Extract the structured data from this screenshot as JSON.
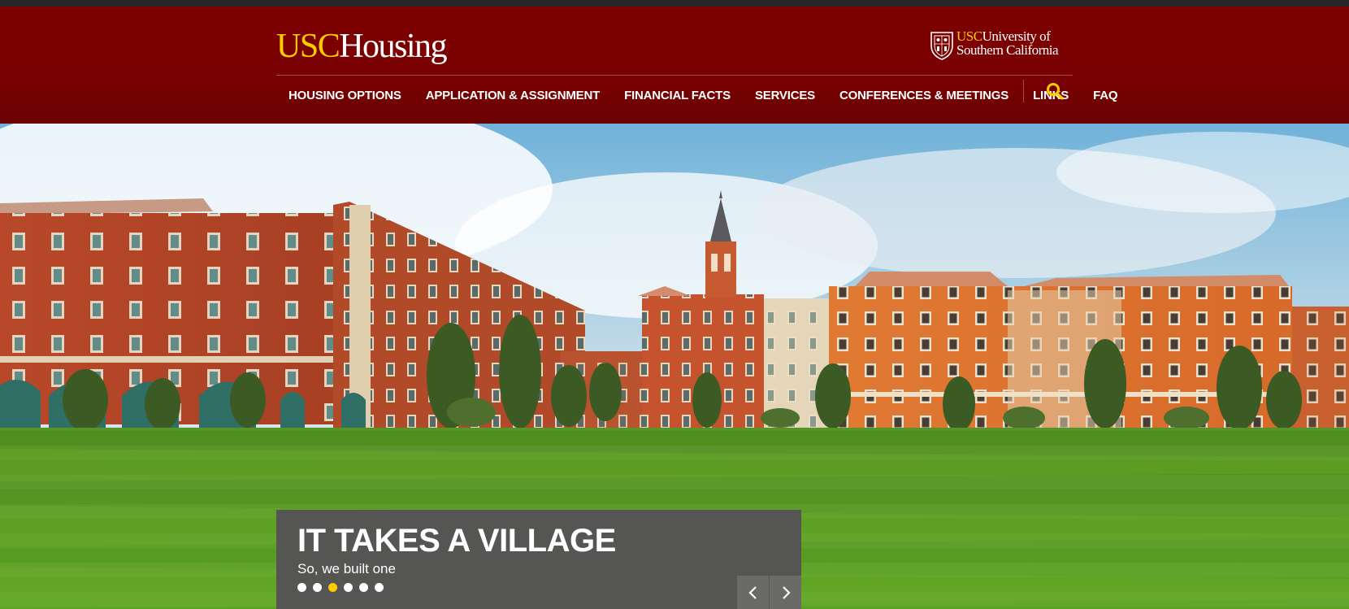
{
  "header": {
    "logo_usc": "USC",
    "logo_housing": "Housing",
    "univ_usc": "USC",
    "univ_line1": "University of",
    "univ_line2": "Southern California"
  },
  "nav": {
    "items": [
      {
        "label": "HOUSING OPTIONS"
      },
      {
        "label": "APPLICATION & ASSIGNMENT"
      },
      {
        "label": "FINANCIAL FACTS"
      },
      {
        "label": "SERVICES"
      },
      {
        "label": "CONFERENCES & MEETINGS"
      },
      {
        "label": "LINKS"
      },
      {
        "label": "FAQ"
      }
    ],
    "search_icon": "search-icon"
  },
  "slider": {
    "title": "IT TAKES A VILLAGE",
    "subtitle": "So, we built one",
    "slide_count": 6,
    "active_slide": 3,
    "prev_icon": "chevron-left-icon",
    "next_icon": "chevron-right-icon"
  },
  "colors": {
    "brand_cardinal": "#7c0000",
    "brand_gold": "#ffcc00",
    "caption_bg": "#555553"
  }
}
